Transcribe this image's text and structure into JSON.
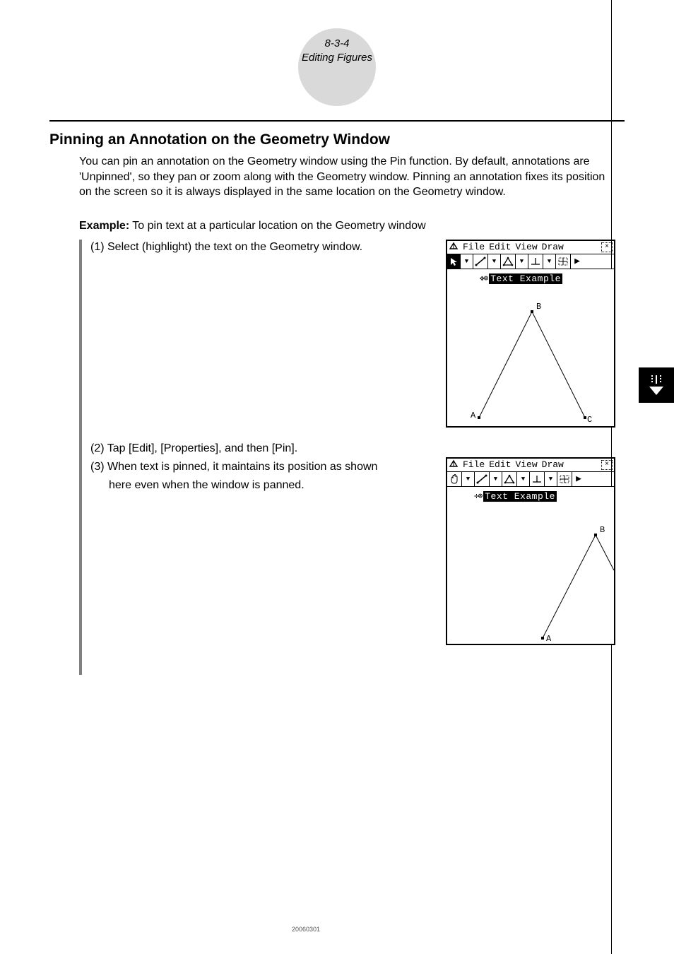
{
  "header": {
    "section_number": "8-3-4",
    "section_title": "Editing Figures"
  },
  "title": "Pinning an Annotation on the Geometry Window",
  "intro": "You can pin an annotation on the Geometry window using the Pin function. By default, annotations are 'Unpinned', so they pan or zoom along with the Geometry window. Pinning an annotation fixes its position on the screen so it is always displayed in the same location on the Geometry window.",
  "example_label": "Example:",
  "example_text": "To pin text at a particular location on the Geometry window",
  "steps": {
    "s1": "(1) Select (highlight) the text on the Geometry window.",
    "s2": "(2) Tap [Edit], [Properties], and then [Pin].",
    "s3a": "(3) When text is pinned, it maintains its position as shown",
    "s3b": "here even when the window is panned."
  },
  "screen_common": {
    "menu_file": "File",
    "menu_edit": "Edit",
    "menu_view": "View",
    "menu_draw": "Draw",
    "close_glyph": "×",
    "annotation_text": "Text Example",
    "point_A": "A",
    "point_B": "B",
    "point_C": "C"
  },
  "footer": "20060301"
}
